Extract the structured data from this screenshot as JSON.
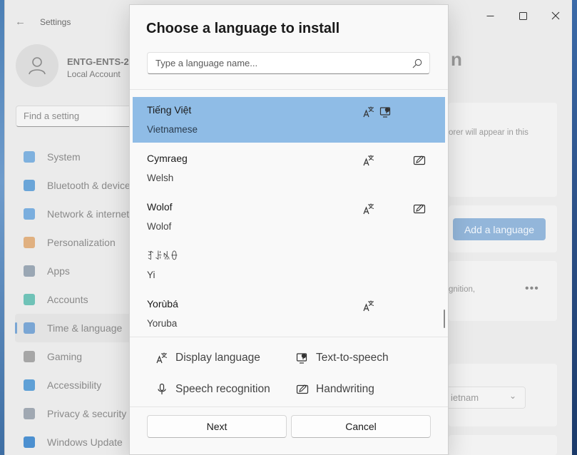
{
  "settings": {
    "app_title": "Settings",
    "user": {
      "name": "ENTG-ENTS-2",
      "account_type": "Local Account"
    },
    "search_placeholder": "Find a setting",
    "nav": [
      {
        "label": "System",
        "icon": "monitor-icon",
        "color": "#7fb1de",
        "active": false
      },
      {
        "label": "Bluetooth & devices",
        "icon": "bluetooth-icon",
        "color": "#6aa5d8",
        "active": false
      },
      {
        "label": "Network & internet",
        "icon": "wifi-icon",
        "color": "#7aaede",
        "active": false
      },
      {
        "label": "Personalization",
        "icon": "brush-icon",
        "color": "#e0b080",
        "active": false
      },
      {
        "label": "Apps",
        "icon": "apps-icon",
        "color": "#9aa7b4",
        "active": false
      },
      {
        "label": "Accounts",
        "icon": "person-icon",
        "color": "#6fc2b7",
        "active": false
      },
      {
        "label": "Time & language",
        "icon": "globe-clock-icon",
        "color": "#7aa6d4",
        "active": true
      },
      {
        "label": "Gaming",
        "icon": "gamepad-icon",
        "color": "#a6a6a6",
        "active": false
      },
      {
        "label": "Accessibility",
        "icon": "accessibility-icon",
        "color": "#5fa0d6",
        "active": false
      },
      {
        "label": "Privacy & security",
        "icon": "shield-icon",
        "color": "#a0a8b2",
        "active": false
      },
      {
        "label": "Windows Update",
        "icon": "update-icon",
        "color": "#4c90d0",
        "active": false
      }
    ],
    "right_title_fragment": "n",
    "card_text_1": "orer will appear in this",
    "add_language_label": "Add a language",
    "card_text_2": "gnition,",
    "region_value": "ietnam"
  },
  "dialog": {
    "title": "Choose a language to install",
    "search_placeholder": "Type a language name...",
    "languages": [
      {
        "native": "Tiếng Việt",
        "english": "Vietnamese",
        "selected": true,
        "features": [
          "display-language-icon",
          "text-to-speech-icon"
        ]
      },
      {
        "native": "Cymraeg",
        "english": "Welsh",
        "selected": false,
        "features": [
          "display-language-icon",
          "handwriting-icon"
        ]
      },
      {
        "native": "Wolof",
        "english": "Wolof",
        "selected": false,
        "features": [
          "display-language-icon",
          "handwriting-icon"
        ]
      },
      {
        "native": "ꆈꌠꁱꂷ",
        "english": "Yi",
        "selected": false,
        "features": []
      },
      {
        "native": "Yorùbá",
        "english": "Yoruba",
        "selected": false,
        "features": [
          "display-language-icon"
        ]
      }
    ],
    "legend": {
      "display_language": "Display language",
      "text_to_speech": "Text-to-speech",
      "speech_recognition": "Speech recognition",
      "handwriting": "Handwriting"
    },
    "next_label": "Next",
    "cancel_label": "Cancel"
  }
}
